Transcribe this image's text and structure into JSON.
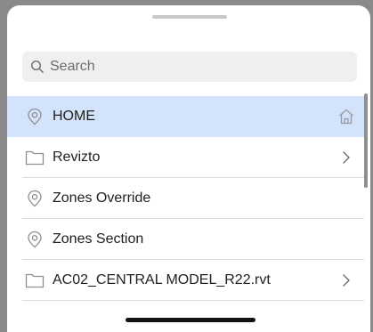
{
  "search": {
    "placeholder": "Search",
    "value": ""
  },
  "items": [
    {
      "label": "HOME",
      "icon": "location-pin-icon",
      "trailing_icon": "home-icon",
      "selected": true
    },
    {
      "label": "Revizto",
      "icon": "folder-icon",
      "trailing_icon": "chevron-right-icon",
      "selected": false
    },
    {
      "label": "Zones Override",
      "icon": "location-pin-icon",
      "trailing_icon": "",
      "selected": false
    },
    {
      "label": "Zones Section",
      "icon": "location-pin-icon",
      "trailing_icon": "",
      "selected": false
    },
    {
      "label": "AC02_CENTRAL MODEL_R22.rvt",
      "icon": "folder-icon",
      "trailing_icon": "chevron-right-icon",
      "selected": false
    }
  ],
  "colors": {
    "selected_row": "#d3e3fb",
    "icon_gray": "#8e8e93",
    "search_bg": "#efeff0"
  }
}
